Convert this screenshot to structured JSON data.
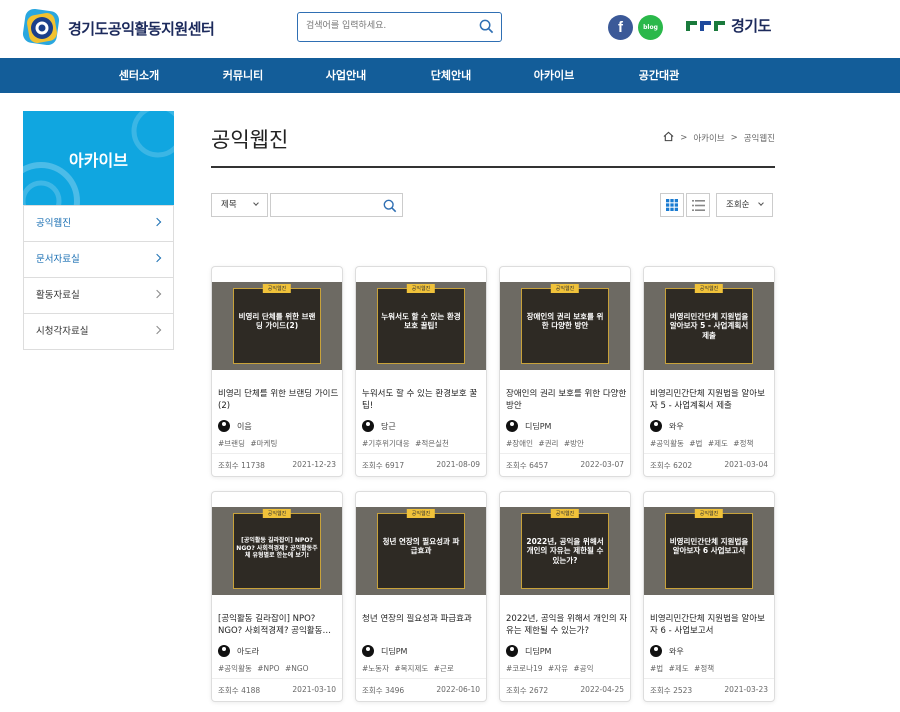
{
  "header": {
    "logo_text": "경기도공익활동지원센터",
    "search_placeholder": "검색어를 입력하세요.",
    "social": {
      "facebook": "f",
      "blog": "blog"
    },
    "gyeonggi_text": "경기도"
  },
  "nav": {
    "items": [
      "센터소개",
      "커뮤니티",
      "사업안내",
      "단체안내",
      "아카이브",
      "공간대관"
    ]
  },
  "sidebar": {
    "title": "아카이브",
    "items": [
      {
        "label": "공익웹진",
        "active": true
      },
      {
        "label": "문서자료실",
        "active": true
      },
      {
        "label": "활동자료실",
        "active": false
      },
      {
        "label": "시청각자료실",
        "active": false
      }
    ]
  },
  "page": {
    "title": "공익웹진",
    "breadcrumb": [
      "아카이브",
      "공익웹진"
    ]
  },
  "filter": {
    "field_select": "제목",
    "search_value": "",
    "sort_select": "조회순"
  },
  "colors": {
    "nav": "#135d99",
    "sidebar_head": "#10a6e0",
    "accent": "#1a6fb3",
    "tag_yellow": "#f0c23a"
  },
  "cards": [
    {
      "thumb_tag": "공익웹진",
      "thumb_title": "비영리 단체를 위한 브랜딩 가이드(2)",
      "title": "비영리 단체를 위한 브랜딩 가이드(2)",
      "author": "이음",
      "tags": "#브랜딩 #마케팅",
      "views": "조회수 11738",
      "date": "2021-12-23"
    },
    {
      "thumb_tag": "공익웹진",
      "thumb_title": "누워서도 할 수 있는 환경보호 꿀팁!",
      "title": "누워서도 할 수 있는 환경보호 꿀팁!",
      "author": "당근",
      "tags": "#기후위기대응 #적은실천",
      "views": "조회수 6917",
      "date": "2021-08-09"
    },
    {
      "thumb_tag": "공익웹진",
      "thumb_title": "장애인의 권리 보호를 위한 다양한 방안",
      "title": "장애인의 권리 보호를 위한 다양한 방안",
      "author": "디딤PM",
      "tags": "#장애인 #권리 #방안",
      "views": "조회수 6457",
      "date": "2022-03-07"
    },
    {
      "thumb_tag": "공익웹진",
      "thumb_title": "비영리민간단체 지원법을 알아보자 5 - 사업계획서 제출",
      "title": "비영리민간단체 지원법을 알아보자 5 - 사업계획서 제출",
      "author": "와우",
      "tags": "#공익활동 #법 #제도 #정책",
      "views": "조회수 6202",
      "date": "2021-03-04"
    },
    {
      "thumb_tag": "공익웹진",
      "thumb_title": "[공익활동 길라잡이] NPO? NGO? 사회적경제? 공익활동주체 유형별로 한눈에 보기!",
      "title": "[공익활동 길라잡이] NPO? NGO? 사회적경제? 공익활동…",
      "author": "아도라",
      "tags": "#공익활동 #NPO #NGO",
      "views": "조회수 4188",
      "date": "2021-03-10"
    },
    {
      "thumb_tag": "공익웹진",
      "thumb_title": "청년 연장의 필요성과 파급효과",
      "title": "청년 연장의 필요성과 파급효과",
      "author": "디딤PM",
      "tags": "#노동자 #복지제도 #근로",
      "views": "조회수 3496",
      "date": "2022-06-10"
    },
    {
      "thumb_tag": "공익웹진",
      "thumb_title": "2022년, 공익을 위해서 개인의 자유는 제한될 수 있는가?",
      "title": "2022년, 공익을 위해서 개인의 자유는 제한될 수 있는가?",
      "author": "디딤PM",
      "tags": "#코로나19 #자유 #공익",
      "views": "조회수 2672",
      "date": "2022-04-25"
    },
    {
      "thumb_tag": "공익웹진",
      "thumb_title": "비영리민간단체 지원법을 알아보자 6 사업보고서",
      "title": "비영리민간단체 지원법을 알아보자 6 - 사업보고서",
      "author": "와우",
      "tags": "#법 #제도 #정책",
      "views": "조회수 2523",
      "date": "2021-03-23"
    }
  ]
}
